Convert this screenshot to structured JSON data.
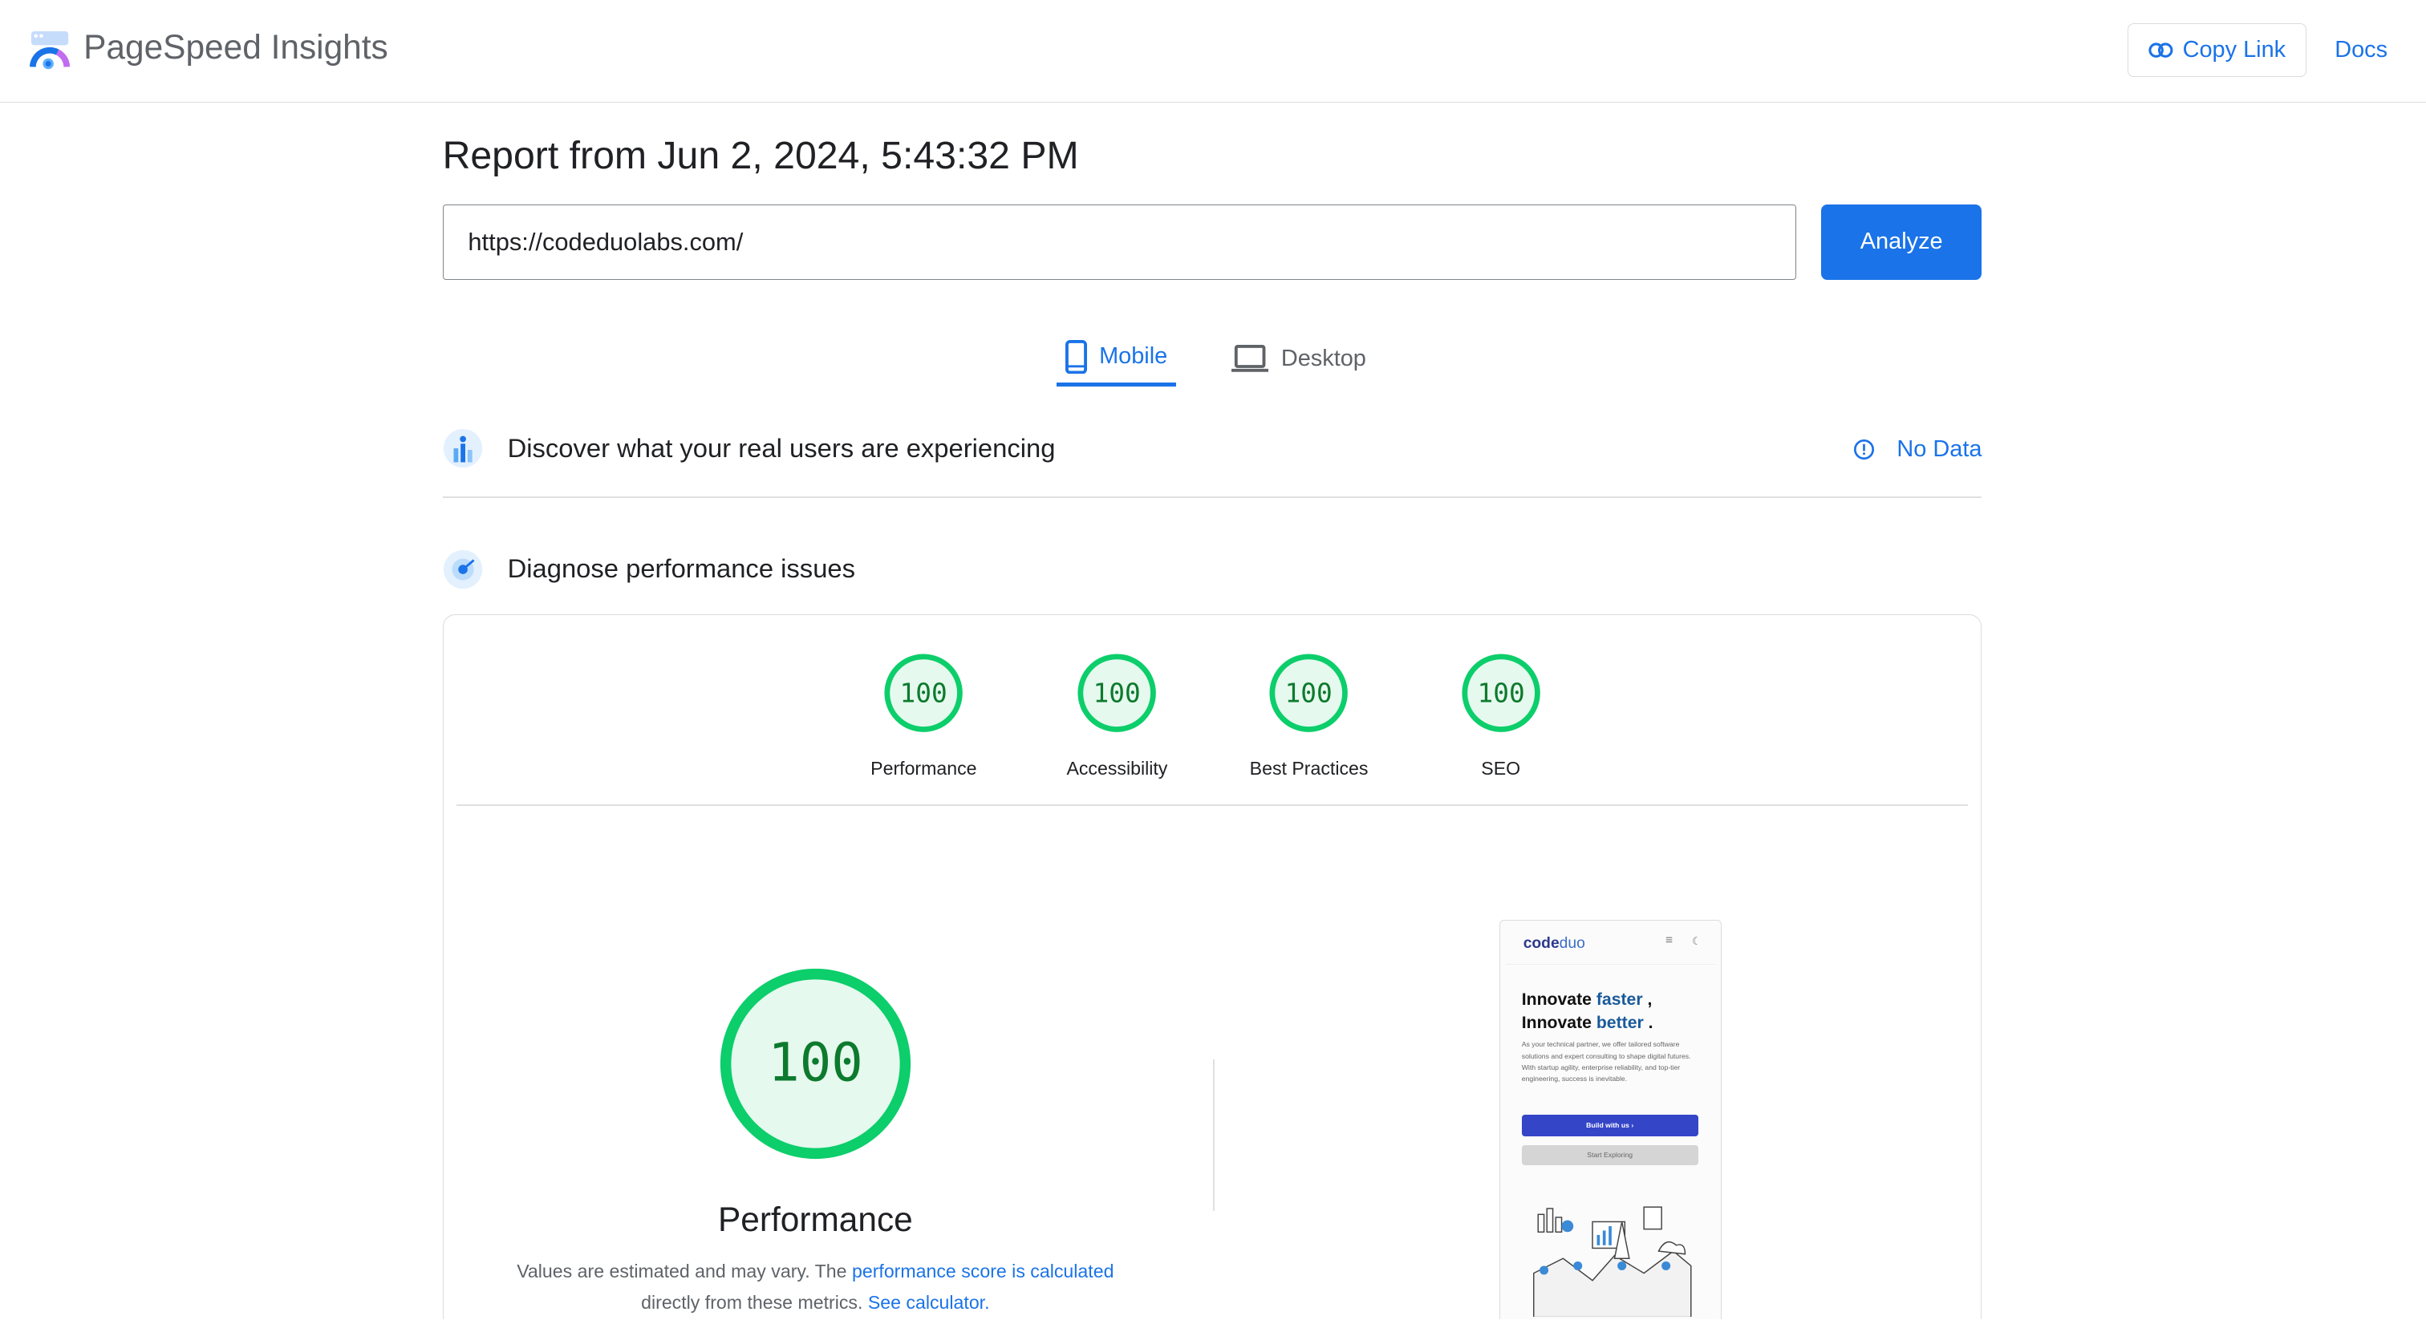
{
  "header": {
    "brand": "PageSpeed Insights",
    "copy_link": "Copy Link",
    "docs": "Docs"
  },
  "report": {
    "title": "Report from Jun 2, 2024, 5:43:32 PM",
    "url": "https://codeduolabs.com/",
    "analyze": "Analyze"
  },
  "tabs": [
    {
      "label": "Mobile",
      "icon": "phone-icon",
      "active": true
    },
    {
      "label": "Desktop",
      "icon": "laptop-icon",
      "active": false
    }
  ],
  "field": {
    "title": "Discover what your real users are experiencing",
    "status": "No Data"
  },
  "lab": {
    "title": "Diagnose performance issues"
  },
  "scores": [
    {
      "label": "Performance",
      "value": "100"
    },
    {
      "label": "Accessibility",
      "value": "100"
    },
    {
      "label": "Best Practices",
      "value": "100"
    },
    {
      "label": "SEO",
      "value": "100"
    }
  ],
  "performance": {
    "value": "100",
    "label": "Performance",
    "desc1": "Values are estimated and may vary. The ",
    "link1": "performance score is calculated",
    "desc2": " directly from these metrics. ",
    "link2": "See calculator."
  },
  "colors": {
    "accent": "#1a73e8",
    "pass": "#0cce6b",
    "pass_text": "#0d7a2e",
    "pass_fill": "#e6f9ee"
  },
  "screenshot": {
    "logo_a": "code",
    "logo_b": "duo",
    "h1a": "Innovate ",
    "h1b": "faster",
    "h1c": " ,",
    "h2a": "Innovate ",
    "h2b": "better",
    "h2c": " .",
    "para": "As your technical partner, we offer tailored software solutions and expert consulting to shape digital futures. With startup agility, enterprise reliability, and top-tier engineering, success is inevitable.",
    "btn1": "Build with us  ›",
    "btn2": "Start Exploring"
  }
}
